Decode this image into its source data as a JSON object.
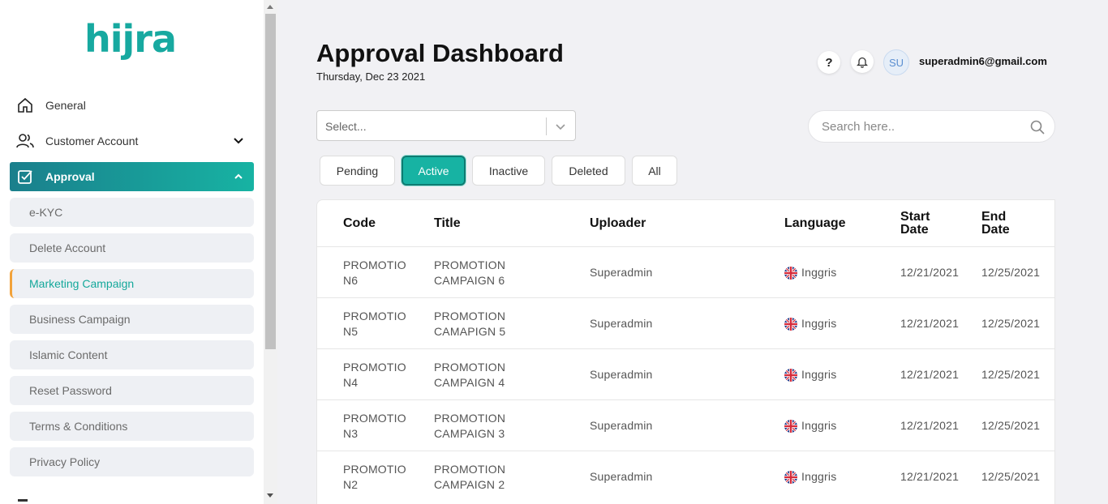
{
  "logo": {
    "text": "hijra",
    "color": "#17a9a0"
  },
  "sidebar": {
    "general": "General",
    "customer_account": "Customer Account",
    "approval": "Approval",
    "sub_items": [
      "e-KYC",
      "Delete Account",
      "Marketing Campaign",
      "Business Campaign",
      "Islamic Content",
      "Reset Password",
      "Terms & Conditions",
      "Privacy Policy"
    ],
    "active_sub_item": "Marketing Campaign"
  },
  "header": {
    "title": "Approval Dashboard",
    "date": "Thursday, Dec 23 2021",
    "help": "?",
    "avatar_initials": "SU",
    "user_email": "superadmin6@gmail.com"
  },
  "filters": {
    "select_placeholder": "Select...",
    "search_placeholder": "Search here..",
    "tabs": [
      "Pending",
      "Active",
      "Inactive",
      "Deleted",
      "All"
    ],
    "active_tab": "Active"
  },
  "table": {
    "columns": [
      "Code",
      "Title",
      "Uploader",
      "Language",
      "Start Date",
      "End Date"
    ],
    "rows": [
      {
        "code": "PROMOTION6",
        "title": "PROMOTION CAMPAIGN 6",
        "uploader": "Superadmin",
        "language": "Inggris",
        "start": "12/21/2021",
        "end": "12/25/2021"
      },
      {
        "code": "PROMOTION5",
        "title": "PROMOTION CAMAPIGN 5",
        "uploader": "Superadmin",
        "language": "Inggris",
        "start": "12/21/2021",
        "end": "12/25/2021"
      },
      {
        "code": "PROMOTION4",
        "title": "PROMOTION CAMPAIGN 4",
        "uploader": "Superadmin",
        "language": "Inggris",
        "start": "12/21/2021",
        "end": "12/25/2021"
      },
      {
        "code": "PROMOTION3",
        "title": "PROMOTION CAMPAIGN 3",
        "uploader": "Superadmin",
        "language": "Inggris",
        "start": "12/21/2021",
        "end": "12/25/2021"
      },
      {
        "code": "PROMOTION2",
        "title": "PROMOTION CAMPAIGN 2",
        "uploader": "Superadmin",
        "language": "Inggris",
        "start": "12/21/2021",
        "end": "12/25/2021"
      }
    ]
  },
  "colors": {
    "accent": "#17b3a3",
    "active_indicator": "#f2a23a"
  }
}
